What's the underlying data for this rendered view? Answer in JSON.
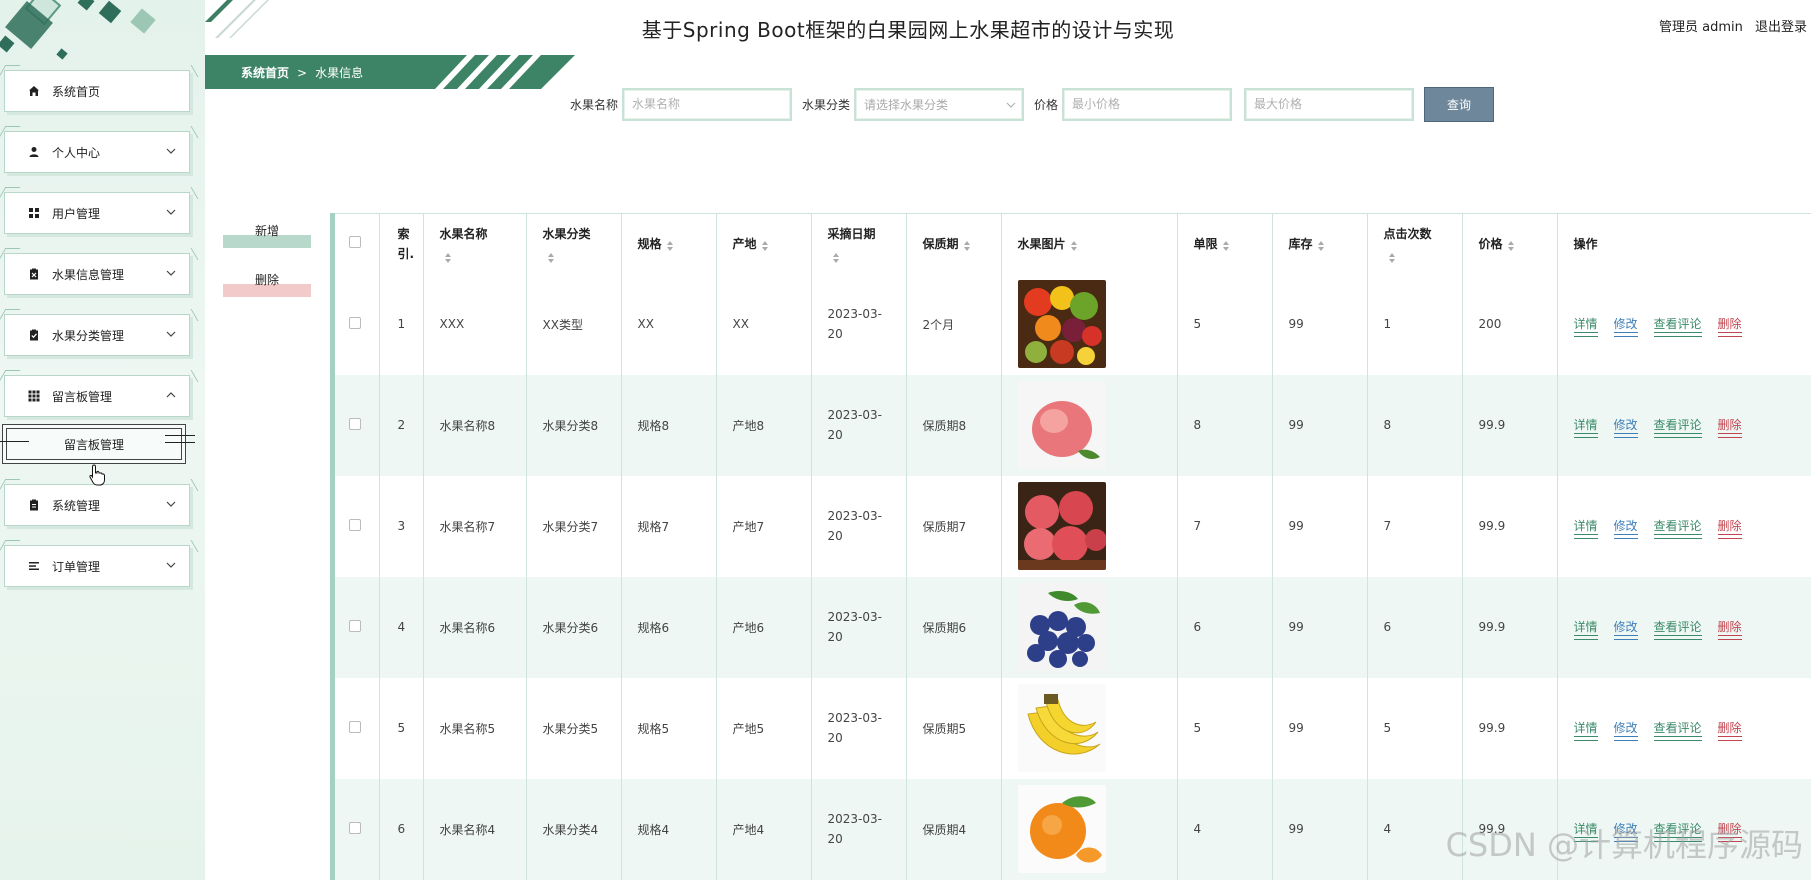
{
  "header": {
    "title": "基于Spring Boot框架的白果园网上水果超市的设计与实现",
    "user": "管理员 admin",
    "logout": "退出登录"
  },
  "breadcrumb": {
    "home": "系统首页",
    "sep": ">",
    "current": "水果信息"
  },
  "sidebar": {
    "items": [
      {
        "label": "系统首页",
        "icon": "home-icon",
        "expandable": false
      },
      {
        "label": "个人中心",
        "icon": "user-icon",
        "expandable": true
      },
      {
        "label": "用户管理",
        "icon": "grid-icon",
        "expandable": true
      },
      {
        "label": "水果信息管理",
        "icon": "clipboard-x-icon",
        "expandable": true
      },
      {
        "label": "水果分类管理",
        "icon": "clipboard-check-icon",
        "expandable": true
      },
      {
        "label": "留言板管理",
        "icon": "apps-icon",
        "expandable": true,
        "expanded": true
      },
      {
        "label": "系统管理",
        "icon": "clipboard-icon",
        "expandable": true
      },
      {
        "label": "订单管理",
        "icon": "list-icon",
        "expandable": true
      }
    ],
    "submenu": {
      "label": "留言板管理"
    }
  },
  "search": {
    "name_label": "水果名称",
    "name_placeholder": "水果名称",
    "category_label": "水果分类",
    "category_placeholder": "请选择水果分类",
    "price_label": "价格",
    "min_placeholder": "最小价格",
    "max_placeholder": "最大价格",
    "query_button": "查询"
  },
  "actions": {
    "add": "新增",
    "delete": "删除"
  },
  "table": {
    "headers": {
      "index": "索引.",
      "name": "水果名称",
      "category": "水果分类",
      "spec": "规格",
      "origin": "产地",
      "date": "采摘日期",
      "shelf": "保质期",
      "image": "水果图片",
      "limit": "单限",
      "stock": "库存",
      "clicks": "点击次数",
      "price": "价格",
      "ops": "操作"
    },
    "ops": {
      "detail": "详情",
      "edit": "修改",
      "review": "查看评论",
      "delete": "删除"
    },
    "rows": [
      {
        "index": "1",
        "name": "XXX",
        "category": "XX类型",
        "spec": "XX",
        "origin": "XX",
        "date": "2023-03-20",
        "shelf": "2个月",
        "image": "fruit-basket",
        "limit": "5",
        "stock": "99",
        "clicks": "1",
        "price": "200"
      },
      {
        "index": "2",
        "name": "水果名称8",
        "category": "水果分类8",
        "spec": "规格8",
        "origin": "产地8",
        "date": "2023-03-20",
        "shelf": "保质期8",
        "image": "peach",
        "limit": "8",
        "stock": "99",
        "clicks": "8",
        "price": "99.9"
      },
      {
        "index": "3",
        "name": "水果名称7",
        "category": "水果分类7",
        "spec": "规格7",
        "origin": "产地7",
        "date": "2023-03-20",
        "shelf": "保质期7",
        "image": "apples",
        "limit": "7",
        "stock": "99",
        "clicks": "7",
        "price": "99.9"
      },
      {
        "index": "4",
        "name": "水果名称6",
        "category": "水果分类6",
        "spec": "规格6",
        "origin": "产地6",
        "date": "2023-03-20",
        "shelf": "保质期6",
        "image": "blueberries",
        "limit": "6",
        "stock": "99",
        "clicks": "6",
        "price": "99.9"
      },
      {
        "index": "5",
        "name": "水果名称5",
        "category": "水果分类5",
        "spec": "规格5",
        "origin": "产地5",
        "date": "2023-03-20",
        "shelf": "保质期5",
        "image": "bananas",
        "limit": "5",
        "stock": "99",
        "clicks": "5",
        "price": "99.9"
      },
      {
        "index": "6",
        "name": "水果名称4",
        "category": "水果分类4",
        "spec": "规格4",
        "origin": "产地4",
        "date": "2023-03-20",
        "shelf": "保质期4",
        "image": "orange",
        "limit": "4",
        "stock": "99",
        "clicks": "4",
        "price": "99.9"
      }
    ]
  },
  "watermark": "CSDN @计算机程序源码",
  "colors": {
    "accent": "#3b8a6a",
    "edit": "#3f7fb8",
    "danger": "#c0454f",
    "query": "#6e879b"
  }
}
